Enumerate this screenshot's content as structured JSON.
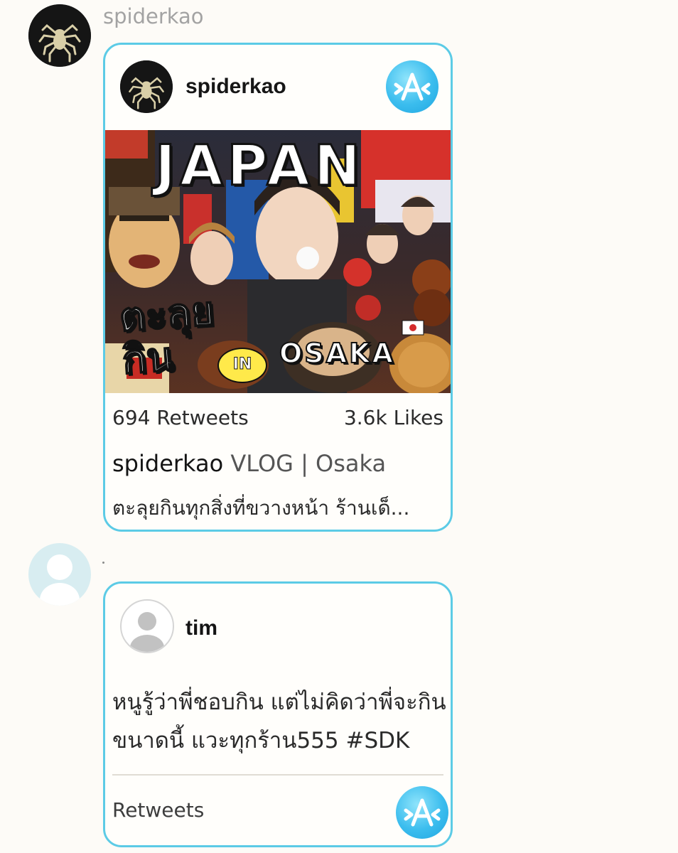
{
  "messages": [
    {
      "sender": "spiderkao",
      "card": {
        "author": "spiderkao",
        "thumbnail": {
          "headline": "JAPAN",
          "thai_caption_line1": "ตะลุย",
          "thai_caption_line2": "กิน",
          "in_label": "IN",
          "location_label": "OSAKA"
        },
        "retweets": "694 Retweets",
        "likes": "3.6k Likes",
        "title_author": "spiderkao",
        "title_rest": " VLOG | Osaka",
        "description": "ตะลุยกินทุกสิ่งที่ขวางหน้า ร้านเด็..."
      }
    },
    {
      "sender": ".",
      "card": {
        "author": "tim",
        "body_line1": "หนูรู้ว่าพี่ชอบกิน แต่ไม่คิดว่าพี่จะกิน",
        "body_line2": "ขนาดนี้ แวะทุกร้าน555 #SDK",
        "retweets_label": "Retweets"
      }
    }
  ],
  "icons": {
    "app_logo": "app-logo-icon",
    "default_avatar": "default-avatar-icon"
  },
  "colors": {
    "card_border": "#5ccbe6",
    "background": "#fdfbf7",
    "logo_blue": "#3bbdee"
  }
}
